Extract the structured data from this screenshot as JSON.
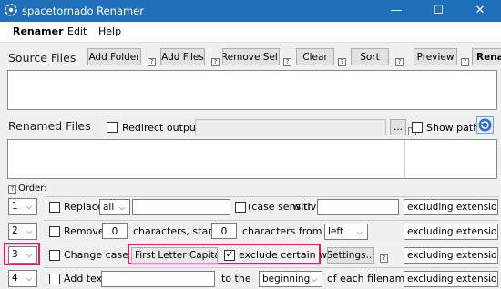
{
  "window": {
    "title": "spacetornado Renamer",
    "controls": {
      "minimize": "—",
      "maximize": "☐",
      "close": "✕"
    }
  },
  "menu": [
    "Renamer",
    "Edit",
    "Help"
  ],
  "toolbar": {
    "source_files_label": "Source Files",
    "add_folder": "Add Folder",
    "add_files": "Add Files",
    "remove_sel": "Remove Sel.",
    "clear": "Clear",
    "sort": "Sort",
    "preview": "Preview",
    "rename": "Renam",
    "help_mark": "?"
  },
  "renamed": {
    "label": "Renamed Files",
    "redirect_label": "Redirect output to:",
    "redirect_value": "",
    "browse": "...",
    "show_paths": "Show paths",
    "refresh_icon": "refresh-icon"
  },
  "order_label": "Order:",
  "rules": [
    {
      "order": "1",
      "checked": false,
      "label": "Replace",
      "mode": "all",
      "find": "",
      "case_label": "(case sensitive)",
      "with_label": "with",
      "replace_with": "",
      "extension": "excluding extension"
    },
    {
      "order": "2",
      "checked": false,
      "label": "Remove",
      "count": "0",
      "mid_label": "characters, starting",
      "start": "0",
      "from_label": "characters from the",
      "side": "left",
      "extension": "excluding extension"
    },
    {
      "order": "3",
      "checked": false,
      "label": "Change case to:",
      "case_value": "First Letter Capital",
      "exclude_checked": true,
      "exclude_label": "exclude certain words",
      "settings": "Settings...",
      "extension": "excluding extension"
    },
    {
      "order": "4",
      "checked": false,
      "label": "Add text",
      "text": "",
      "to_label": "to the",
      "position": "beginning",
      "tail_label": "of each filename.",
      "extension": "excluding extension"
    }
  ],
  "colors": {
    "titlebar": "#1f6fb9",
    "highlight": "#e6196a",
    "panel": "#f0f0f0"
  }
}
